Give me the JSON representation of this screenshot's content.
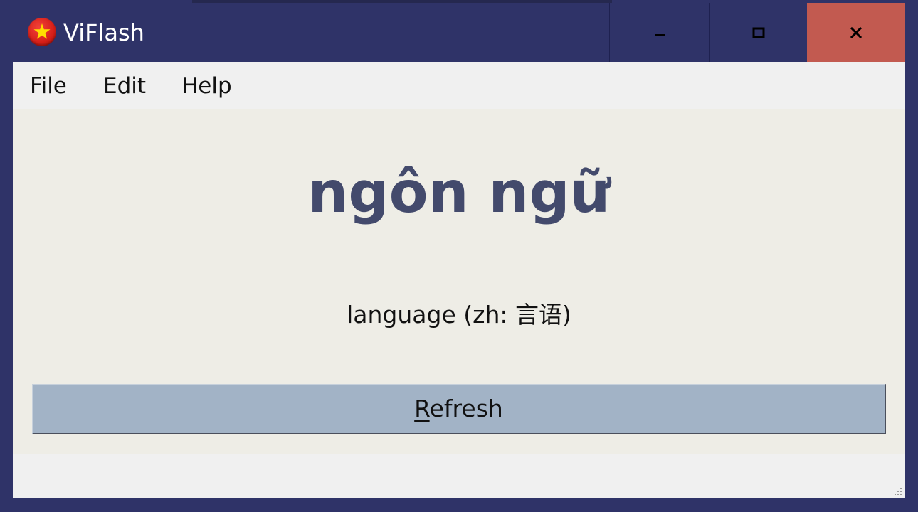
{
  "window": {
    "title": "ViFlash",
    "icon": "vietnam-flag-icon",
    "controls": {
      "minimize": "minimize-icon",
      "maximize": "maximize-icon",
      "close": "close-icon"
    }
  },
  "menu": {
    "items": [
      {
        "label": "File"
      },
      {
        "label": "Edit"
      },
      {
        "label": "Help"
      }
    ]
  },
  "card": {
    "word": "ngôn ngữ",
    "translation": "language (zh: 言语)"
  },
  "refresh_button": {
    "mnemonic": "R",
    "rest": "efresh"
  },
  "colors": {
    "titlebar": "#2f3368",
    "close_button": "#c25a50",
    "panel": "#eeede6",
    "word": "#434a6c",
    "button": "#a2b3c6"
  }
}
